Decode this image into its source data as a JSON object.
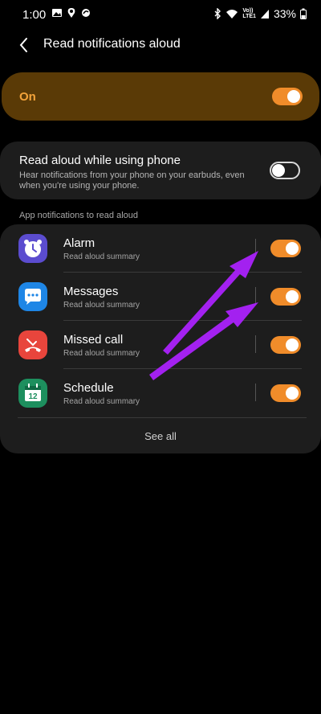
{
  "status_bar": {
    "time": "1:00",
    "network_label_top": "Vo))",
    "network_label_bottom": "LTE1",
    "battery_percent": "33%"
  },
  "header": {
    "title": "Read notifications aloud",
    "back_icon": "chevron-left-icon"
  },
  "master_toggle": {
    "label": "On",
    "state": true,
    "accent": "#f08c2a"
  },
  "read_aloud_using_phone": {
    "title": "Read aloud while using phone",
    "description": "Hear notifications from your phone on your earbuds, even when you're using your phone.",
    "state": false
  },
  "apps_section": {
    "label": "App notifications to read aloud",
    "apps": [
      {
        "name": "Alarm",
        "subtitle": "Read aloud summary",
        "icon": "alarm-clock-icon",
        "enabled": true,
        "color": "#5b4ccf"
      },
      {
        "name": "Messages",
        "subtitle": "Read aloud summary",
        "icon": "messages-icon",
        "enabled": true,
        "color": "#1e86e6"
      },
      {
        "name": "Missed call",
        "subtitle": "Read aloud summary",
        "icon": "missed-call-icon",
        "enabled": true,
        "color": "#e8453c"
      },
      {
        "name": "Schedule",
        "subtitle": "Read aloud summary",
        "icon": "calendar-icon",
        "enabled": true,
        "color": "#1d8f5e",
        "icon_text": "12"
      }
    ],
    "see_all": "See all"
  }
}
